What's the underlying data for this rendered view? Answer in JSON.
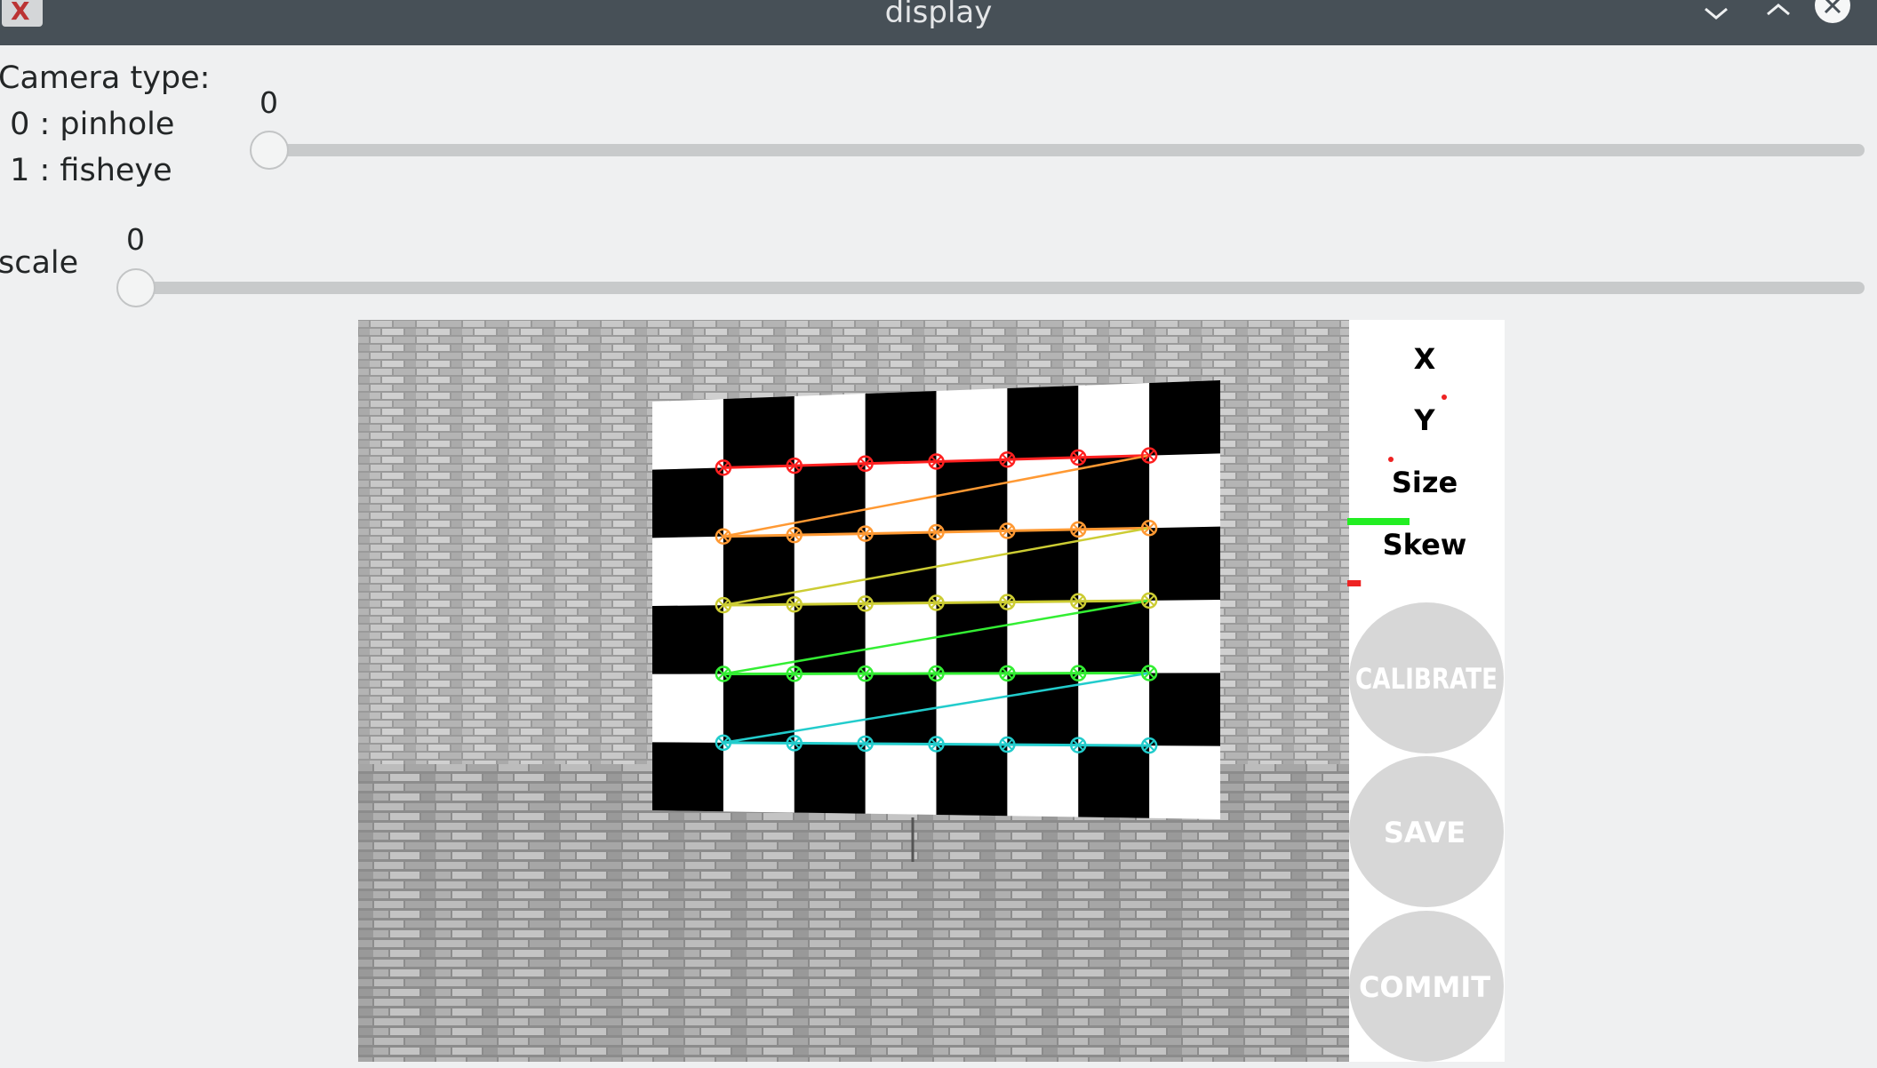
{
  "window": {
    "title": "display",
    "app_icon": "cv-app-icon",
    "controls": [
      "minimize-icon",
      "maximize-icon",
      "close-icon"
    ]
  },
  "trackbars": {
    "camera_type": {
      "label_lines": [
        "Camera type:",
        " 0 : pinhole",
        " 1 : fisheye"
      ],
      "value": "0",
      "position": 0
    },
    "scale": {
      "label": "scale",
      "value": "0",
      "position": 0
    }
  },
  "progress": {
    "x_label": "X",
    "y_label": "Y",
    "size_label": "Size",
    "skew_label": "Skew",
    "x_fraction": 0.0,
    "y_fraction": 0.0,
    "size_fraction": 0.4,
    "skew_fraction": 0.03
  },
  "buttons": {
    "calibrate": "CALIBRATE",
    "save": "SAVE",
    "commit": "COMMIT"
  },
  "colors": {
    "row1": "#ff2020",
    "row2": "#ff9933",
    "row3": "#cccc33",
    "row4": "#33ee33",
    "row5": "#22cccc",
    "size_bar": "#22ee22",
    "skew_bar": "#ee2222"
  }
}
